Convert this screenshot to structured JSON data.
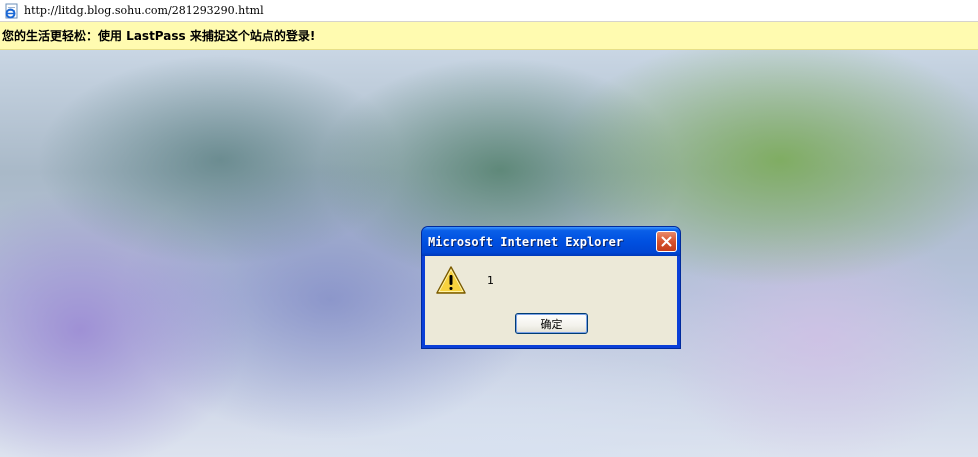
{
  "address_bar": {
    "url": "http://litdg.blog.sohu.com/281293290.html",
    "icon": "ie-page-icon"
  },
  "notification_bar": {
    "text": "您的生活更轻松：使用 LastPass 来捕捉这个站点的登录!",
    "background": "#fffbb0"
  },
  "dialog": {
    "title": "Microsoft Internet Explorer",
    "message": "1",
    "ok_label": "确定",
    "icon": "warning-icon",
    "close_icon": "close-icon",
    "titlebar_color": "#0050e0"
  }
}
